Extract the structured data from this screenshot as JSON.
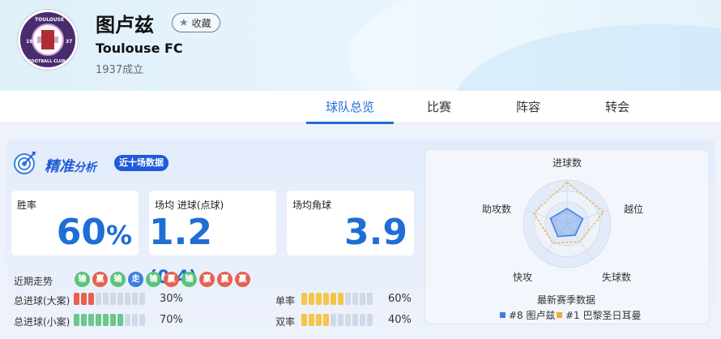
{
  "team": {
    "name": "图卢兹",
    "name_en": "Toulouse FC",
    "founded": "1937成立",
    "favorite_label": "收藏",
    "logo_text": {
      "top": "TOULOUSE",
      "bottom": "FOOTBALL CLUB",
      "left": "19",
      "right": "37"
    }
  },
  "tabs": [
    {
      "label": "球队总览",
      "active": true
    },
    {
      "label": "比赛",
      "active": false
    },
    {
      "label": "阵容",
      "active": false
    },
    {
      "label": "转会",
      "active": false
    }
  ],
  "analysis": {
    "title": "精准",
    "title_suffix": "分析",
    "tag": "近十场数据",
    "cards": [
      {
        "label": "胜率",
        "value": "60",
        "unit": "%"
      },
      {
        "label": "场均 进球(点球)",
        "value": "1.2",
        "sub": "(0.4)"
      },
      {
        "label": "场均角球",
        "value": "3.9"
      }
    ],
    "form_label": "近期走势",
    "form": [
      {
        "text": "输",
        "type": "loss"
      },
      {
        "text": "赢",
        "type": "win"
      },
      {
        "text": "输",
        "type": "loss"
      },
      {
        "text": "走",
        "type": "draw"
      },
      {
        "text": "输",
        "type": "loss"
      },
      {
        "text": "赢",
        "type": "win"
      },
      {
        "text": "输",
        "type": "loss"
      },
      {
        "text": "赢",
        "type": "win"
      },
      {
        "text": "赢",
        "type": "win"
      },
      {
        "text": "赢",
        "type": "win"
      }
    ],
    "stats": [
      {
        "label": "总进球(大案)",
        "percent": "30%",
        "filled": 3,
        "color": "red"
      },
      {
        "label": "总进球(小案)",
        "percent": "70%",
        "filled": 7,
        "color": "green"
      },
      {
        "label": "单率",
        "percent": "60%",
        "filled": 6,
        "color": "yellow"
      },
      {
        "label": "双率",
        "percent": "40%",
        "filled": 4,
        "color": "yellow"
      }
    ]
  },
  "radar": {
    "axes": [
      "进球数",
      "越位",
      "失球数",
      "快攻",
      "助攻数"
    ],
    "caption": "最新赛季数据",
    "series": [
      {
        "name": "#8 图卢兹",
        "color": "#3d7ee0",
        "values": [
          0.35,
          0.38,
          0.32,
          0.36,
          0.4
        ]
      },
      {
        "name": "#1 巴黎圣日耳曼",
        "color": "#f0a83a",
        "values": [
          0.95,
          0.88,
          0.5,
          0.55,
          0.8
        ]
      }
    ]
  }
}
